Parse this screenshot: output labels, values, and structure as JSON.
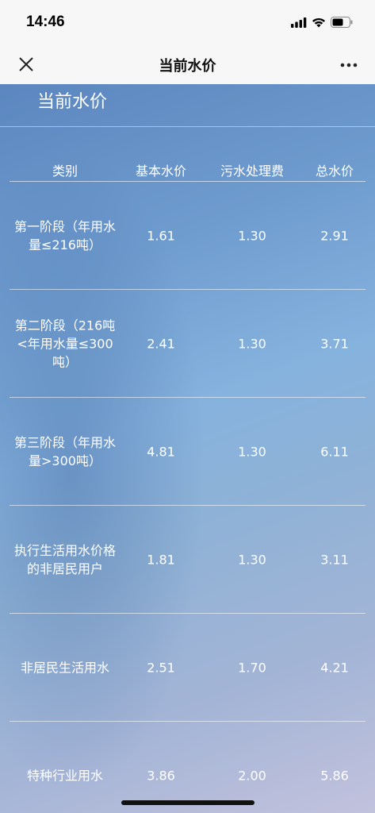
{
  "status_bar": {
    "time": "14:46"
  },
  "nav": {
    "title": "当前水价"
  },
  "page": {
    "heading": "当前水价"
  },
  "table": {
    "headers": [
      "类别",
      "基本水价",
      "污水处理费",
      "总水价"
    ],
    "rows": [
      {
        "category": "第一阶段（年用水量≤216吨）",
        "base": "1.61",
        "sewage": "1.30",
        "total": "2.91"
      },
      {
        "category": "第二阶段（216吨<年用水量≤300吨）",
        "base": "2.41",
        "sewage": "1.30",
        "total": "3.71"
      },
      {
        "category": "第三阶段（年用水量>300吨）",
        "base": "4.81",
        "sewage": "1.30",
        "total": "6.11"
      },
      {
        "category": "执行生活用水价格的非居民用户",
        "base": "1.81",
        "sewage": "1.30",
        "total": "3.11"
      },
      {
        "category": "非居民生活用水",
        "base": "2.51",
        "sewage": "1.70",
        "total": "4.21"
      },
      {
        "category": "特种行业用水",
        "base": "3.86",
        "sewage": "2.00",
        "total": "5.86"
      }
    ]
  },
  "icons": {
    "close": "close-icon",
    "more": "more-icon",
    "signal": "signal-icon",
    "wifi": "wifi-icon",
    "battery": "battery-icon"
  }
}
